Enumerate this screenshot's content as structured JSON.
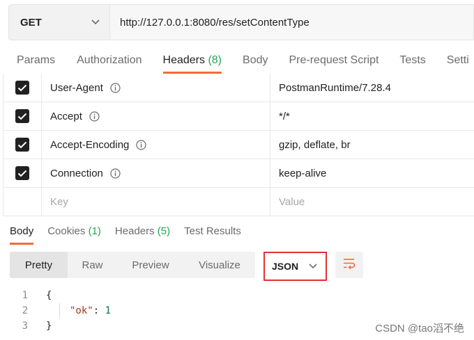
{
  "request": {
    "method": "GET",
    "url": "http://127.0.0.1:8080/res/setContentType"
  },
  "request_tabs": [
    {
      "label": "Params",
      "count": ""
    },
    {
      "label": "Authorization",
      "count": ""
    },
    {
      "label": "Headers",
      "count": "(8)"
    },
    {
      "label": "Body",
      "count": ""
    },
    {
      "label": "Pre-request Script",
      "count": ""
    },
    {
      "label": "Tests",
      "count": ""
    },
    {
      "label": "Setti",
      "count": ""
    }
  ],
  "headers": [
    {
      "key": "User-Agent",
      "value": "PostmanRuntime/7.28.4",
      "checked": true
    },
    {
      "key": "Accept",
      "value": "*/*",
      "checked": true
    },
    {
      "key": "Accept-Encoding",
      "value": "gzip, deflate, br",
      "checked": true
    },
    {
      "key": "Connection",
      "value": "keep-alive",
      "checked": true
    }
  ],
  "new_row": {
    "key_placeholder": "Key",
    "value_placeholder": "Value"
  },
  "response_tabs": [
    {
      "label": "Body",
      "count": ""
    },
    {
      "label": "Cookies",
      "count": "(1)"
    },
    {
      "label": "Headers",
      "count": "(5)"
    },
    {
      "label": "Test Results",
      "count": ""
    }
  ],
  "format_options": [
    "Pretty",
    "Raw",
    "Preview",
    "Visualize"
  ],
  "format_selected": "Pretty",
  "language": "JSON",
  "code_lines": [
    {
      "n": "1",
      "text": "{"
    },
    {
      "n": "2",
      "key": "\"ok\"",
      "colon": ": ",
      "value": "1"
    },
    {
      "n": "3",
      "text": "}"
    }
  ],
  "watermark": "CSDN @tao滔不绝",
  "colors": {
    "accent": "#f26b3a",
    "count_green": "#26a35a",
    "highlight_border": "#e03131"
  },
  "icons": {
    "method_dropdown": "chevron-down-icon",
    "info": "info-icon",
    "checkbox": "check-icon",
    "wrap": "wrap-lines-icon"
  }
}
